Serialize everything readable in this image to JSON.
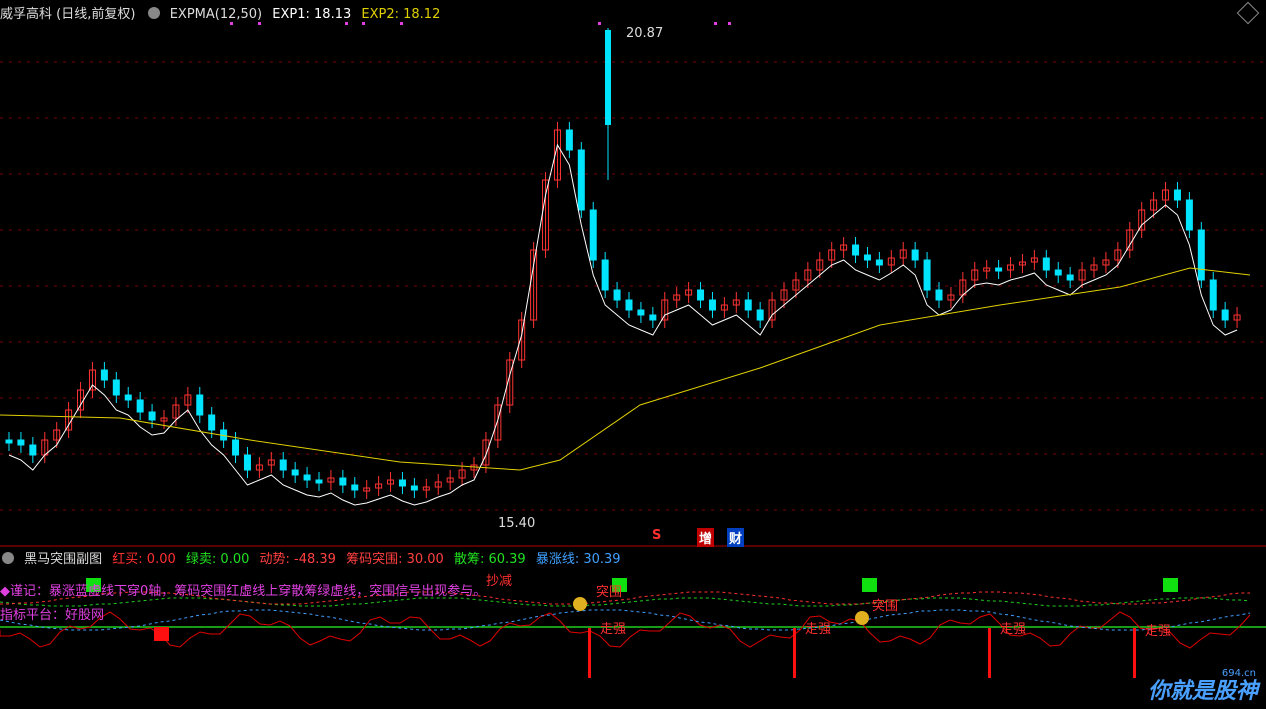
{
  "header": {
    "title": "威孚高科 (日线,前复权)",
    "indicator": "EXPMA(12,50)",
    "exp1": "EXP1: 18.13",
    "exp2": "EXP2: 18.12"
  },
  "price_labels": {
    "high": "20.87",
    "low": "15.40"
  },
  "flags": {
    "s": "S",
    "zeng": "增",
    "cai": "财"
  },
  "sub": {
    "title": "黑马突围副图",
    "red_buy": "红买: 0.00",
    "green_sell": "绿卖: 0.00",
    "momentum": "动势: -48.39",
    "chip_break": "筹码突围: 30.00",
    "scatter": "散筹: 60.39",
    "surge": "暴涨线: 30.39",
    "note1": "◆谨记：暴涨蓝虚线下穿0轴，筹码突围红虚线上穿散筹绿虚线，突围信号出现参与。",
    "note2": "指标平台：好股网",
    "labels": {
      "breakout": "突围",
      "strong": "走强",
      "reduce": "抄减"
    }
  },
  "watermark": {
    "text": "你就是股神",
    "site": "694.cn"
  },
  "colors": {
    "up": "#ff3333",
    "down": "#00e5ff",
    "exp1": "#ffffff",
    "exp2": "#e0d000"
  }
}
